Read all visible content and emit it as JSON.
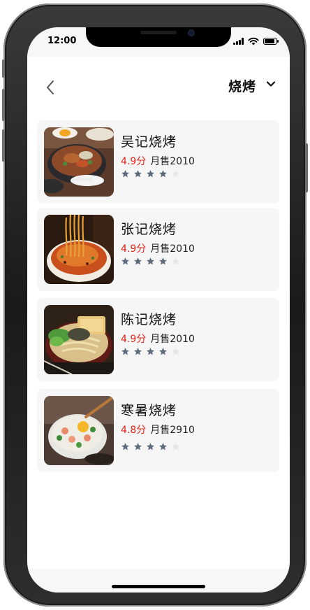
{
  "status_bar": {
    "time": "12:00"
  },
  "header": {
    "title": "烧烤"
  },
  "colors": {
    "score_red": "#e2231a",
    "star_filled": "#5c6a7d",
    "star_empty": "#e6e6e6",
    "card_bg": "#f6f6f6"
  },
  "icons": {
    "back": "chevron-left-icon",
    "dropdown": "chevron-down-icon",
    "star": "star-icon"
  },
  "shops": [
    {
      "name": "吴记烧烤",
      "score": "4.9分",
      "sales": "月售2010",
      "stars": 4,
      "max_stars": 5,
      "image": "rice-bowl-photo"
    },
    {
      "name": "张记烧烤",
      "score": "4.9分",
      "sales": "月售2010",
      "stars": 4,
      "max_stars": 5,
      "image": "noodle-bowl-photo"
    },
    {
      "name": "陈记烧烤",
      "score": "4.9分",
      "sales": "月售2010",
      "stars": 4,
      "max_stars": 5,
      "image": "ramen-bowl-photo"
    },
    {
      "name": "寒暑烧烤",
      "score": "4.8分",
      "sales": "月售2910",
      "stars": 4,
      "max_stars": 5,
      "image": "poke-bowl-photo"
    }
  ]
}
